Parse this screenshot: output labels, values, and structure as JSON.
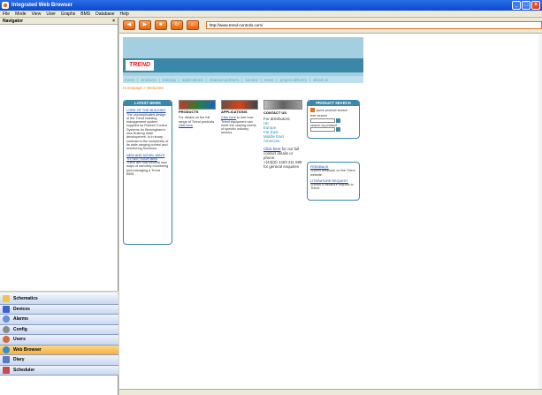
{
  "window": {
    "title": "Integrated Web Browser"
  },
  "menu": [
    "File",
    "Mode",
    "View",
    "User",
    "Graphs",
    "BMS",
    "Database",
    "Help"
  ],
  "navigator": {
    "title": "Navigator",
    "pin": "×",
    "items": [
      {
        "label": "Schematics",
        "icon_color": "#f2c447"
      },
      {
        "label": "Devices",
        "icon_color": "#3a64c8"
      },
      {
        "label": "Alarms",
        "icon_color": "#6a8bd8"
      },
      {
        "label": "Config",
        "icon_color": "#8a8a8a"
      },
      {
        "label": "Users",
        "icon_color": "#d46a3a"
      },
      {
        "label": "Web Browser",
        "icon_color": "#3a8ac8",
        "active": true
      },
      {
        "label": "Diary",
        "icon_color": "#5a7ac8"
      },
      {
        "label": "Scheduler",
        "icon_color": "#c84a4a"
      }
    ],
    "more": "»"
  },
  "browser": {
    "buttons": [
      "back-button",
      "forward-button",
      "stop-button",
      "refresh-button",
      "home-button"
    ],
    "address": "http://www.trend-controls.com/"
  },
  "site": {
    "logo": "TREND",
    "nav": [
      "home",
      "products",
      "training",
      "applications",
      "channel partners",
      "service",
      "news",
      "project delivery",
      "about us"
    ],
    "crumb": "Homepage > Welcome",
    "latest_news": {
      "heading": "LATEST NEWS",
      "item1_title": "LORD OF THE BUILDING",
      "item1_text": "The uncomplicated design of the Trend building management system supplied by Rotwell Control Systems for Birmingham's new Bullring retail development, is in sharp contrast to the complexity of its wide-ranging control and monitoring functions.",
      "item2_title": "NEW AND NOVEL WAYS TO SEE YOUR BMS",
      "item2_text": "There are now several new ways of remotely monitoring and managing a Trend BMS."
    },
    "products": {
      "title": "PRODUCTS",
      "text": "For details on the full range of Trend products",
      "link": "click here"
    },
    "applications": {
      "title": "APPLICATIONS",
      "link": "Click here",
      "text": "to see how Trend equipment can meet the varying needs of specific industry sectors."
    },
    "contact": {
      "title": "CONTACT US",
      "distributors": "For distributors:",
      "regions": [
        "UK",
        "Europe",
        "Far East",
        "Middle East",
        "Americas"
      ],
      "link": "Click here",
      "text": "for our full contact details or phone:",
      "phone": "+(44)(0) 1403 211 888",
      "phone_suffix": "for general enquiries"
    },
    "product_search": {
      "heading": "PRODUCT SEARCH",
      "quick": "quick product search",
      "free": "free search",
      "search_by": "search by product"
    },
    "feedback": {
      "title": "FEEDBACK",
      "text": "Submit feedback on the Trend website.",
      "lit_title": "LITERATURE REQUEST",
      "lit_text": "Submit a literature request to Trend."
    }
  }
}
